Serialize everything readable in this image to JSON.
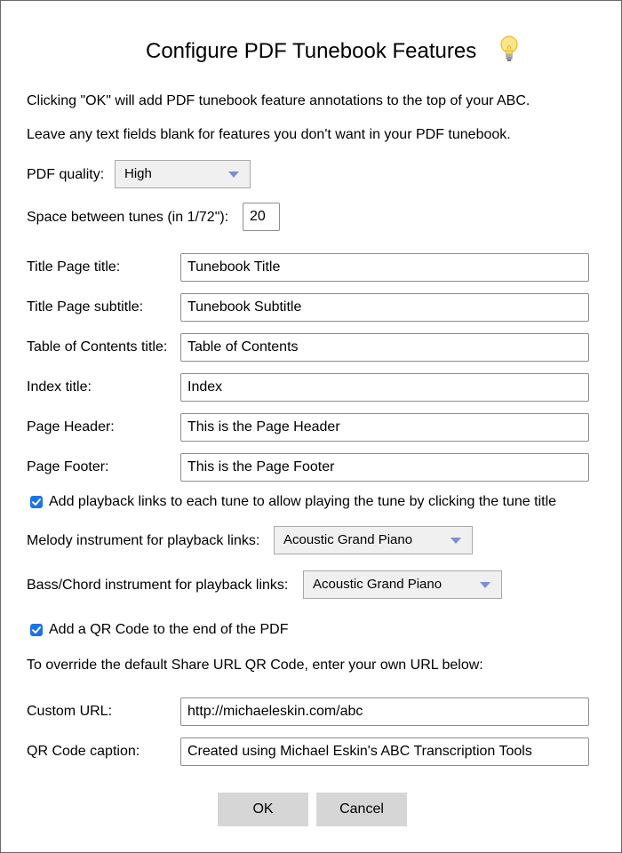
{
  "dialog": {
    "title": "Configure PDF Tunebook Features",
    "help_icon": "lightbulb-icon",
    "intro_line1": "Clicking \"OK\" will add PDF tunebook feature annotations to the top of your ABC.",
    "intro_line2": "Leave any text fields blank for features you don't want in your PDF tunebook."
  },
  "pdf_quality": {
    "label": "PDF quality:",
    "value": "High"
  },
  "spacing": {
    "label": "Space between tunes (in 1/72\"):",
    "value": "20"
  },
  "fields": {
    "title_page_title": {
      "label": "Title Page title:",
      "value": "Tunebook Title"
    },
    "title_page_subtitle": {
      "label": "Title Page subtitle:",
      "value": "Tunebook Subtitle"
    },
    "toc_title": {
      "label": "Table of Contents title:",
      "value": "Table of Contents"
    },
    "index_title": {
      "label": "Index title:",
      "value": "Index"
    },
    "page_header": {
      "label": "Page Header:",
      "value": "This is the Page Header"
    },
    "page_footer": {
      "label": "Page Footer:",
      "value": "This is the Page Footer"
    }
  },
  "playback": {
    "checkbox_label": "Add playback links to each tune to allow playing the tune by clicking the tune title",
    "checked": true,
    "melody_label": "Melody instrument for playback links:",
    "melody_value": "Acoustic Grand Piano",
    "bass_label": "Bass/Chord instrument for playback links:",
    "bass_value": "Acoustic Grand Piano"
  },
  "qr": {
    "checkbox_label": "Add a QR Code to the end of the PDF",
    "checked": true,
    "override_text": "To override the default Share URL QR Code, enter your own URL below:",
    "url_label": "Custom URL:",
    "url_value": "http://michaeleskin.com/abc",
    "caption_label": "QR Code caption:",
    "caption_value": "Created using Michael Eskin's ABC Transcription Tools"
  },
  "buttons": {
    "ok": "OK",
    "cancel": "Cancel"
  },
  "colors": {
    "checkbox": "#1a73e8",
    "select_caret": "#7d8fd0",
    "button_bg": "#d6d6d6"
  }
}
